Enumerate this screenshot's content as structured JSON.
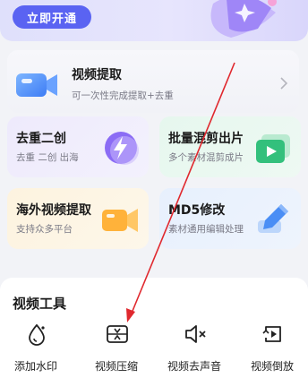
{
  "banner": {
    "open_label": "立即开通"
  },
  "extract": {
    "title": "视频提取",
    "subtitle": "可一次性完成提取+去重"
  },
  "tiles": [
    {
      "title": "去重二创",
      "subtitle": "去重 二创 出海"
    },
    {
      "title": "批量混剪出片",
      "subtitle": "多个素材混剪成片"
    },
    {
      "title": "海外视频提取",
      "subtitle": "支持众多平台"
    },
    {
      "title": "MD5修改",
      "subtitle": "素材通用编辑处理"
    }
  ],
  "tools": {
    "title": "视频工具",
    "items": [
      {
        "label": "添加水印",
        "icon": "watermark-icon"
      },
      {
        "label": "视频压缩",
        "icon": "compress-icon"
      },
      {
        "label": "视频去声音",
        "icon": "mute-icon"
      },
      {
        "label": "视频倒放",
        "icon": "reverse-icon"
      }
    ]
  },
  "colors": {
    "accent": "#5a63f2",
    "annotation_arrow": "#e0282e"
  }
}
